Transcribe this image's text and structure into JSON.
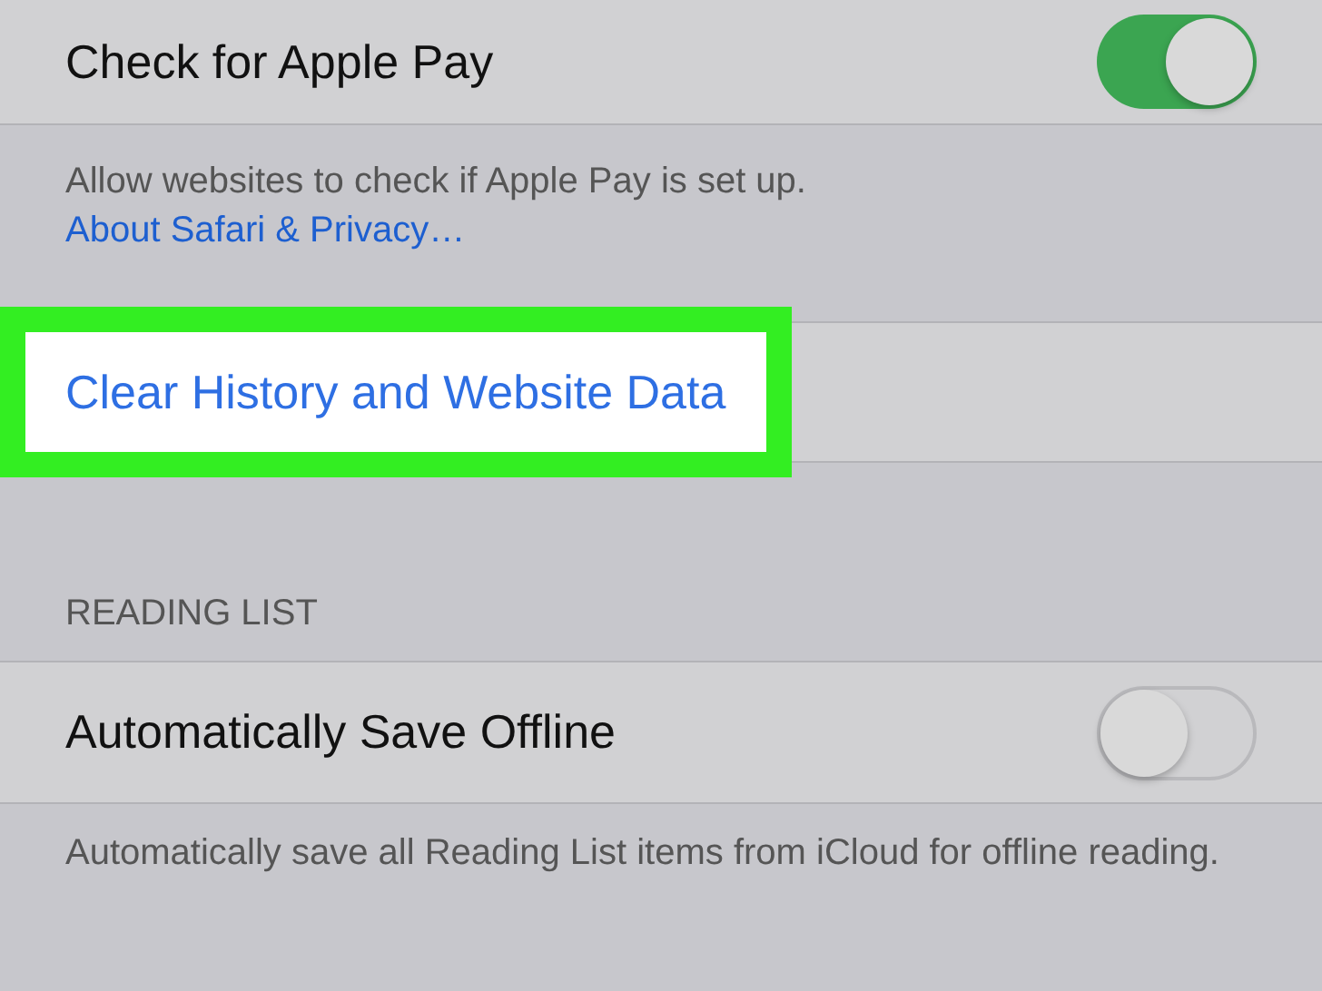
{
  "apple_pay": {
    "label": "Check for Apple Pay",
    "on": true
  },
  "apple_pay_footer": {
    "text": "Allow websites to check if Apple Pay is set up.",
    "link": "About Safari & Privacy…"
  },
  "clear_history": {
    "label": "Clear History and Website Data",
    "highlighted": true
  },
  "reading_list": {
    "header": "READING LIST",
    "label": "Automatically Save Offline",
    "on": false,
    "footer": "Automatically save all Reading List items from iCloud for offline reading."
  }
}
